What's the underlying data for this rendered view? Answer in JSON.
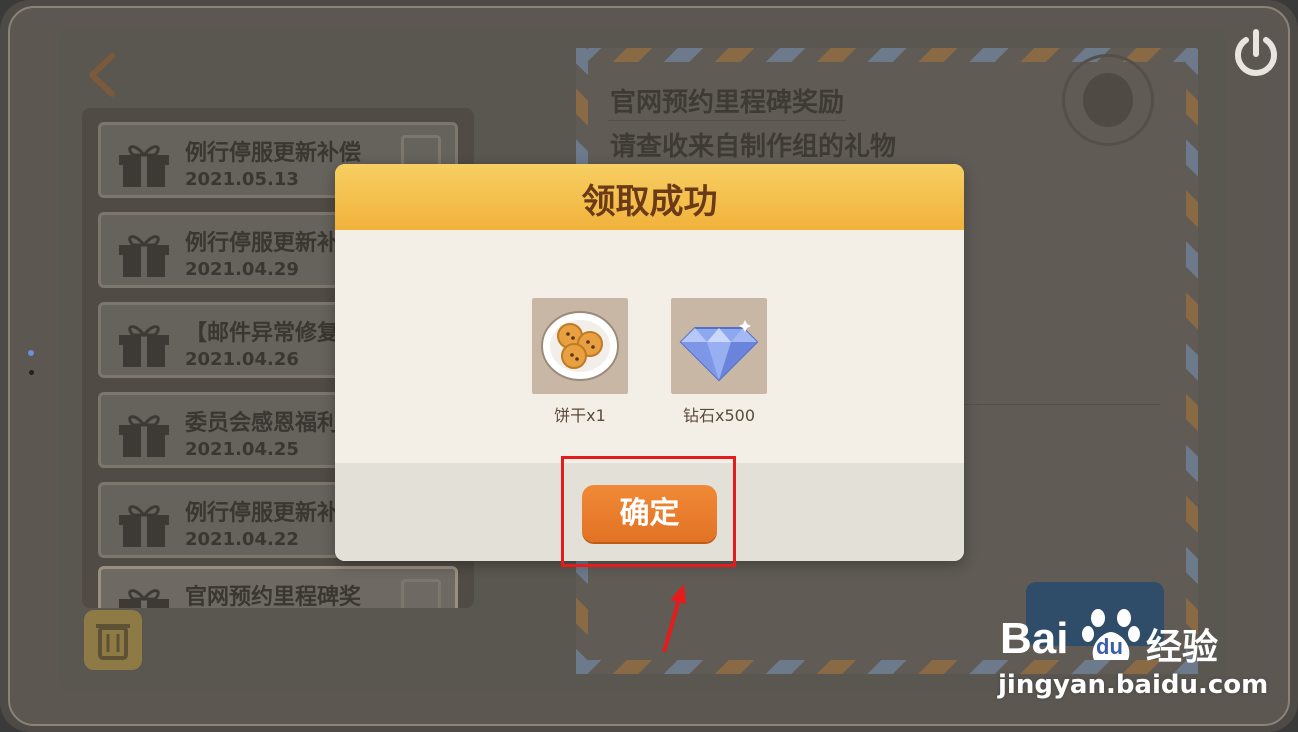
{
  "mail_list": {
    "items": [
      {
        "title": "例行停服更新补偿",
        "date": "2021.05.13"
      },
      {
        "title": "例行停服更新补",
        "date": "2021.04.29"
      },
      {
        "title": "【邮件异常修复",
        "date": "2021.04.26"
      },
      {
        "title": "委员会感恩福利",
        "date": "2021.04.25"
      },
      {
        "title": "例行停服更新补",
        "date": "2021.04.22"
      },
      {
        "title": "官网预约里程碑奖",
        "date": ""
      }
    ]
  },
  "letter": {
    "title": "官网预约里程碑奖励",
    "subtitle": "请查收来自制作组的礼物"
  },
  "dialog": {
    "title": "领取成功",
    "rewards": [
      {
        "name": "饼干x1",
        "icon": "cookie-plate-icon"
      },
      {
        "name": "钻石x500",
        "icon": "diamond-icon"
      }
    ],
    "confirm_label": "确定"
  },
  "watermark": {
    "brand_left": "Bai",
    "brand_mid": "du",
    "brand_right": "经验",
    "url": "jingyan.baidu.com"
  },
  "colors": {
    "header": "#f1b23b",
    "confirm": "#e27224",
    "highlight": "#e61b1b"
  }
}
